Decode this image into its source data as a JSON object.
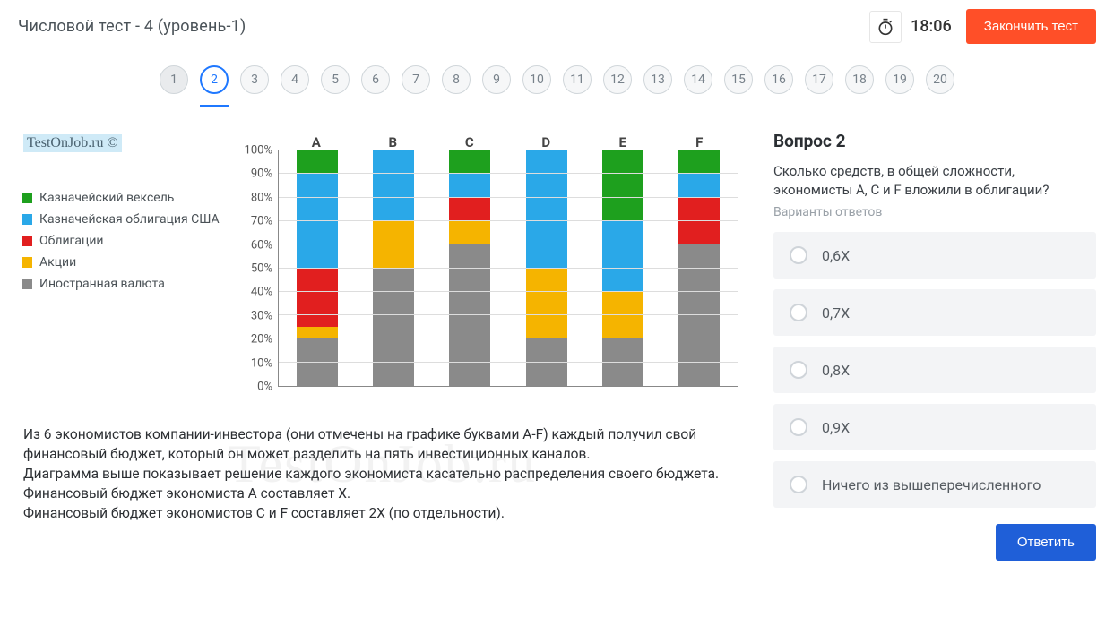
{
  "header": {
    "title": "Числовой тест - 4 (уровень-1)",
    "timer": "18:06",
    "end_label": "Закончить тест"
  },
  "qnav": {
    "items": [
      "1",
      "2",
      "3",
      "4",
      "5",
      "6",
      "7",
      "8",
      "9",
      "10",
      "11",
      "12",
      "13",
      "14",
      "15",
      "16",
      "17",
      "18",
      "19",
      "20"
    ],
    "current_index": 1,
    "answered_indices": [
      0
    ]
  },
  "watermark_small": "TestOnJob.ru ©",
  "watermark_big": "TestOnJob.ru",
  "legend": [
    {
      "label": "Казначейский вексель",
      "color": "#1ea01e"
    },
    {
      "label": "Казначейская облигация США",
      "color": "#2aa8e8"
    },
    {
      "label": "Облигации",
      "color": "#e11f1f"
    },
    {
      "label": "Акции",
      "color": "#f5b400"
    },
    {
      "label": "Иностранная валюта",
      "color": "#8a8a8a"
    }
  ],
  "chart_data": {
    "type": "stacked-bar-100",
    "categories": [
      "A",
      "B",
      "C",
      "D",
      "E",
      "F"
    ],
    "series_order": [
      "Иностранная валюта",
      "Акции",
      "Облигации",
      "Казначейская облигация США",
      "Казначейский вексель"
    ],
    "colors": {
      "Иностранная валюта": "#8a8a8a",
      "Акции": "#f5b400",
      "Облигации": "#e11f1f",
      "Казначейская облигация США": "#2aa8e8",
      "Казначейский вексель": "#1ea01e"
    },
    "data": {
      "A": {
        "Иностранная валюта": 20,
        "Акции": 5,
        "Облигации": 25,
        "Казначейская облигация США": 40,
        "Казначейский вексель": 10
      },
      "B": {
        "Иностранная валюта": 50,
        "Акции": 20,
        "Облигации": 0,
        "Казначейская облигация США": 30,
        "Казначейский вексель": 0
      },
      "C": {
        "Иностранная валюта": 60,
        "Акции": 10,
        "Облигации": 10,
        "Казначейская облигация США": 10,
        "Казначейский вексель": 10
      },
      "D": {
        "Иностранная валюта": 20,
        "Акции": 30,
        "Облигации": 0,
        "Казначейская облигация США": 50,
        "Казначейский вексель": 0
      },
      "E": {
        "Иностранная валюта": 20,
        "Акции": 20,
        "Облигации": 0,
        "Казначейская облигация США": 30,
        "Казначейский вексель": 30
      },
      "F": {
        "Иностранная валюта": 60,
        "Акции": 0,
        "Облигации": 20,
        "Казначейская облигация США": 10,
        "Казначейский вексель": 10
      }
    },
    "ylabel": "%",
    "ylim": [
      0,
      100
    ],
    "y_ticks": [
      "0%",
      "10%",
      "20%",
      "30%",
      "40%",
      "50%",
      "60%",
      "70%",
      "80%",
      "90%",
      "100%"
    ]
  },
  "description": {
    "p1": "Из 6 экономистов компании-инвестора (они отмечены на графике буквами A-F) каждый получил свой финансовый бюджет, который он может разделить на пять инвестиционных каналов.",
    "p2": "Диаграмма выше показывает решение каждого экономиста касательно распределения своего бюджета.",
    "p3": "Финансовый бюджет экономиста А составляет X.",
    "p4": "Финансовый бюджет экономистов C и F составляет 2X  (по отдельности)."
  },
  "question": {
    "title": "Вопрос 2",
    "text": "Сколько средств, в общей сложности, экономисты A, C и F вложили в облигации?",
    "hint": "Варианты ответов",
    "options": [
      "0,6X",
      "0,7X",
      "0,8X",
      "0,9X",
      "Ничего из вышеперечисленного"
    ],
    "answer_label": "Ответить"
  }
}
